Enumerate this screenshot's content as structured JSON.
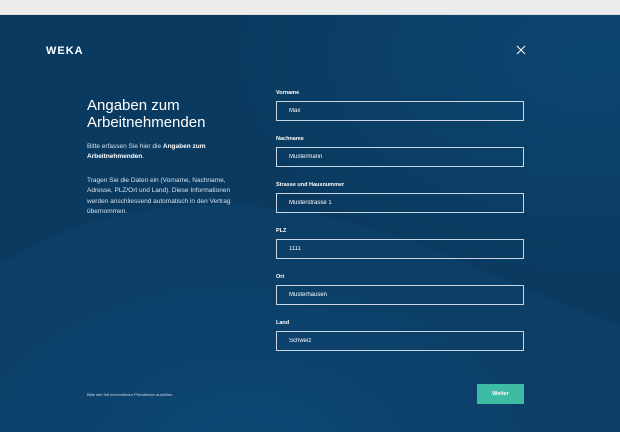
{
  "brand": {
    "logo_text": "WEKA"
  },
  "header": {
    "close_icon": "close-icon"
  },
  "intro": {
    "title": "Angaben zum Arbeitnehmenden",
    "lead_prefix": "Bitte erfassen Sie hier die ",
    "lead_bold": "Angaben zum Arbeitnehmenden",
    "lead_suffix": ".",
    "info": "Tragen Sie die Daten ein (Vorname, Nachname, Adresse, PLZ/Ort und Land). Diese Informationen werden anschliessend automatisch in den Vertrag übernommen."
  },
  "form": {
    "vorname": {
      "label": "Vorname",
      "value": "Max"
    },
    "nachname": {
      "label": "Nachname",
      "value": "Mustermann"
    },
    "strasse": {
      "label": "Strasse und Hausnummer",
      "value": "Musterstrasse 1"
    },
    "plz": {
      "label": "PLZ",
      "value": "1111"
    },
    "ort": {
      "label": "Ort",
      "value": "Musterhausen"
    },
    "land": {
      "label": "Land",
      "value": "Schweiz"
    }
  },
  "footer": {
    "note": "Bitte alle fett beschrifteten Pflichtfelder ausfüllen.",
    "next_label": "Weiter"
  },
  "colors": {
    "background": "#0a3a60",
    "accent": "#3dbca3",
    "field_border": "#c9d6e2"
  }
}
